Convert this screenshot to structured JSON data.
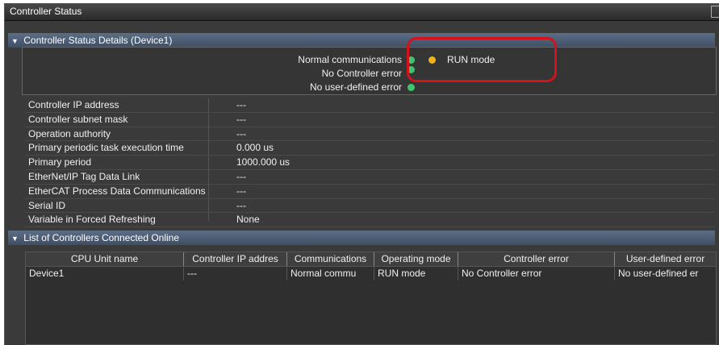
{
  "window": {
    "title": "Controller Status"
  },
  "details": {
    "header": "Controller Status Details (Device1)",
    "status_lines": [
      {
        "text": "Normal communications",
        "indicator": "green"
      },
      {
        "text": "No Controller error",
        "indicator": "green"
      },
      {
        "text": "No user-defined error",
        "indicator": "green"
      }
    ],
    "mode_label": "RUN mode",
    "mode_indicator": "yellow",
    "properties": [
      {
        "key": "Controller IP address",
        "value": "---"
      },
      {
        "key": "Controller subnet mask",
        "value": "---"
      },
      {
        "key": "Operation authority",
        "value": "---"
      },
      {
        "key": "Primary periodic task execution time",
        "value": "0.000 us"
      },
      {
        "key": "Primary period",
        "value": "1000.000 us"
      },
      {
        "key": "EtherNet/IP Tag Data Link",
        "value": "---"
      },
      {
        "key": "EtherCAT Process Data Communications",
        "value": "---"
      },
      {
        "key": "Serial ID",
        "value": "---"
      },
      {
        "key": "Variable in Forced Refreshing",
        "value": "None"
      }
    ]
  },
  "online_list": {
    "header": "List of Controllers Connected Online",
    "columns": [
      "CPU Unit name",
      "Controller IP addres",
      "Communications",
      "Operating mode",
      "Controller error",
      "User-defined error"
    ],
    "rows": [
      [
        "Device1",
        "---",
        "Normal commu",
        "RUN mode",
        "No Controller error",
        "No user-defined er"
      ]
    ]
  },
  "colors": {
    "green": "#3ec46d",
    "yellow": "#f0b418",
    "highlight": "#d5121b",
    "header_bg": "#4a5c73",
    "panel_bg": "#3a3a3a"
  }
}
